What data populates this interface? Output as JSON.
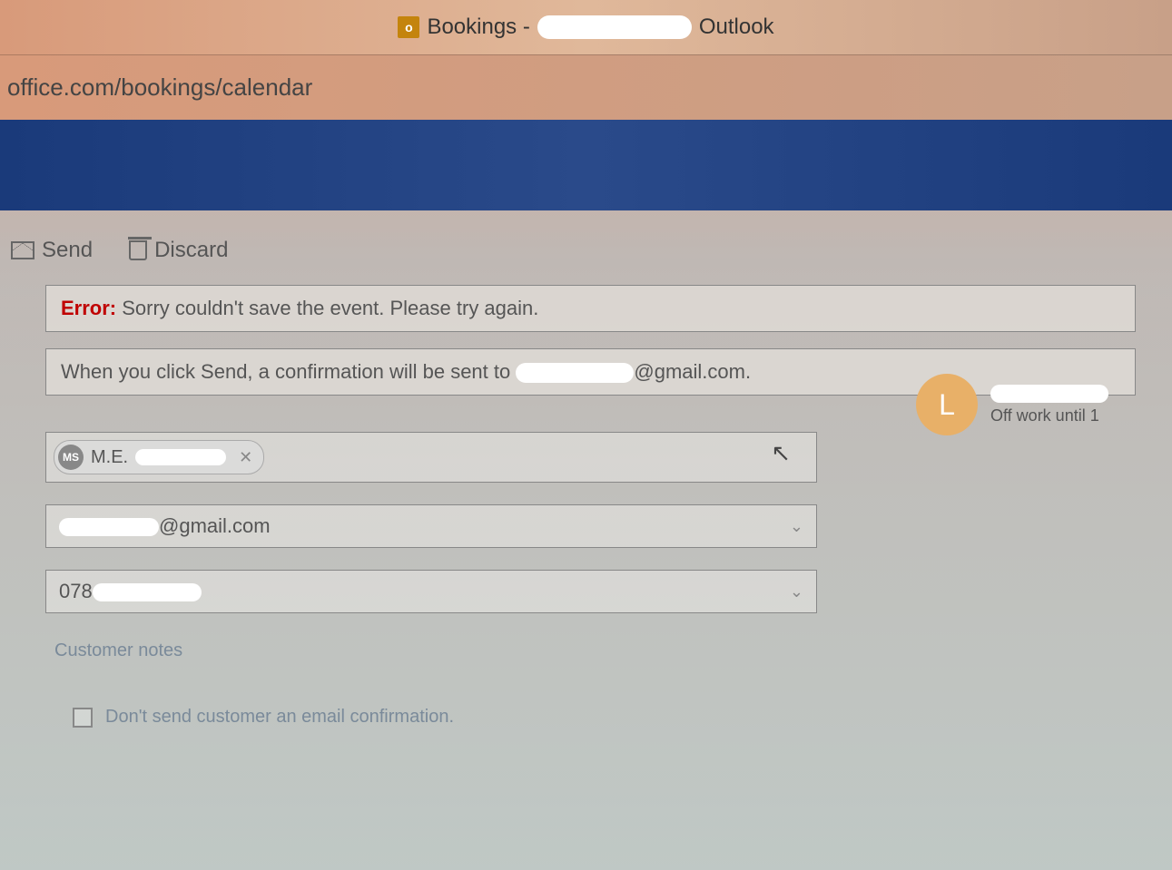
{
  "browser": {
    "title_prefix": "Bookings -",
    "title_suffix": "Outlook",
    "url": "office.com/bookings/calendar"
  },
  "toolbar": {
    "send_label": "Send",
    "discard_label": "Discard"
  },
  "error": {
    "label": "Error:",
    "message": "Sorry couldn't save the event. Please try again."
  },
  "info": {
    "prefix": "When you click Send, a confirmation will be sent to",
    "suffix": "@gmail.com."
  },
  "customer": {
    "chip_initials": "MS",
    "chip_name": "M.E.",
    "email_suffix": "@gmail.com",
    "phone_prefix": "078"
  },
  "notes": {
    "placeholder": "Customer notes"
  },
  "checkbox": {
    "dont_send_label": "Don't send customer an email confirmation."
  },
  "staff": {
    "avatar_initial": "L",
    "status": "Off work until 1"
  }
}
